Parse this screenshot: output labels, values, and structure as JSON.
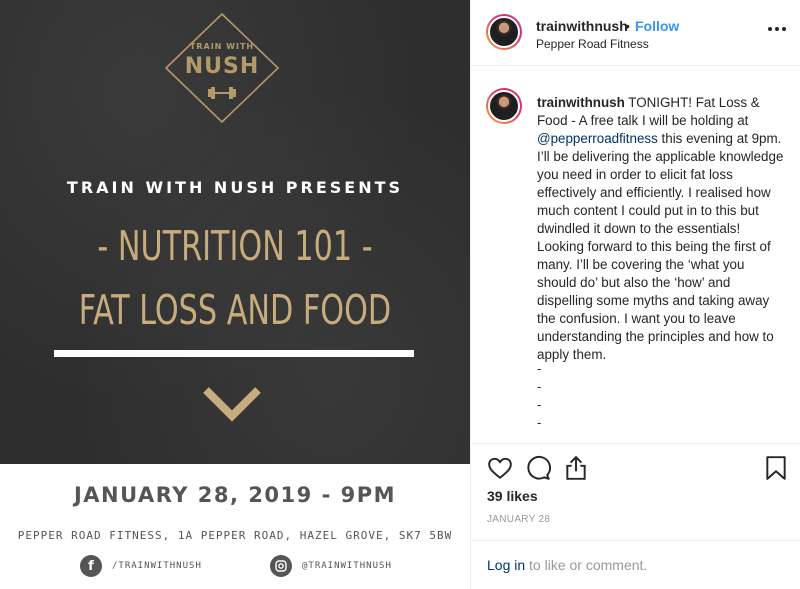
{
  "image": {
    "logo_top": "TRAIN WITH",
    "logo_main": "NUSH",
    "presents": "TRAIN WITH NUSH PRESENTS",
    "headline_1": "- NUTRITION 101 -",
    "headline_2": "FAT LOSS AND FOOD",
    "date": "JANUARY 28, 2019 - 9PM",
    "address": "PEPPER ROAD FITNESS, 1A PEPPER ROAD, HAZEL GROVE, SK7 5BW",
    "facebook_handle": "/TRAINWITHNUSH",
    "instagram_handle": "@TRAINWITHNUSH",
    "facebook_icon": "facebook-icon",
    "instagram_icon": "instagram-icon",
    "colors": {
      "chalkboard": "#2e2e2e",
      "gold": "#c7ad7e",
      "footer_text": "#555555"
    }
  },
  "header": {
    "username": "trainwithnush",
    "separator": "•",
    "follow_label": "Follow",
    "location": "Pepper Road Fitness",
    "more_icon": "more-options-icon"
  },
  "caption": {
    "username": "trainwithnush",
    "text_1": "TONIGHT! Fat Loss & Food - A free talk I will be holding at",
    "mention": "@pepperroadfitness",
    "text_2": "this evening at 9pm. I’ll be delivering the applicable knowledge you need in order to elicit fat loss effectively and efficiently. I realised how much content I could put in to this but dwindled it down to the essentials! Looking forward to this being the first of many. I’ll be covering the ‘what you should do’ but also the ‘how’ and dispelling some myths and taking away the confusion. I want you to leave understanding the principles and how to apply them.",
    "dashes": [
      "-",
      "-",
      "-",
      "-"
    ]
  },
  "actions": {
    "like_icon": "heart-icon",
    "comment_icon": "comment-icon",
    "share_icon": "share-icon",
    "save_icon": "bookmark-icon"
  },
  "likes": "39 likes",
  "post_date": "JANUARY 28",
  "login": {
    "link": "Log in",
    "rest": "to like or comment."
  },
  "colors": {
    "accent": "#3897f0",
    "link_dark": "#003569",
    "muted": "#999999"
  }
}
